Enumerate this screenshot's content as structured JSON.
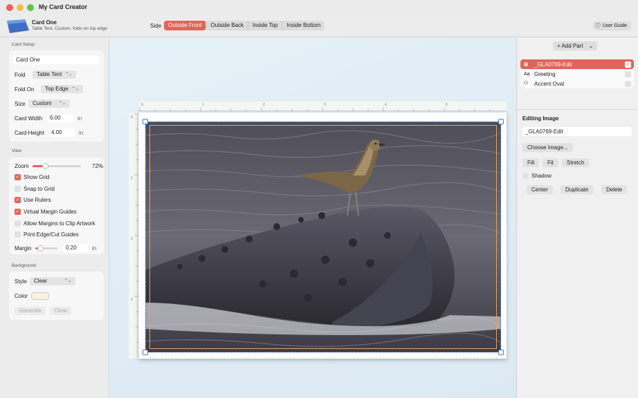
{
  "window": {
    "title": "My Card Creator"
  },
  "header": {
    "doc_name": "Card One",
    "doc_subtitle": "Table Tent, Custom, folds on top edge",
    "side_label": "Side",
    "tabs": [
      {
        "label": "Outside Front",
        "active": true
      },
      {
        "label": "Outside Back",
        "active": false
      },
      {
        "label": "Inside Top",
        "active": false
      },
      {
        "label": "Inside Bottom",
        "active": false
      }
    ],
    "user_guide_label": "User Guide"
  },
  "card_setup": {
    "title": "Card Setup",
    "name": "Card One",
    "fold_label": "Fold",
    "fold_value": "Table Tent",
    "fold_on_label": "Fold On",
    "fold_on_value": "Top Edge",
    "size_label": "Size",
    "size_value": "Custom",
    "width_label": "Card Width",
    "width_value": "6.00",
    "width_unit": "in",
    "height_label": "Card Height",
    "height_value": "4.00",
    "height_unit": "in"
  },
  "view": {
    "title": "View",
    "zoom_label": "Zoom",
    "zoom_value": "72%",
    "zoom_level": 0.72,
    "show_grid": {
      "label": "Show Grid",
      "checked": true
    },
    "snap_to_grid": {
      "label": "Snap to Grid",
      "checked": false
    },
    "use_rulers": {
      "label": "Use Rulers",
      "checked": true
    },
    "virtual_margin_guides": {
      "label": "Virtual Margin Guides",
      "checked": true
    },
    "allow_margins_clip": {
      "label": "Allow Margins to Clip Artwork",
      "checked": false
    },
    "print_edge_guides": {
      "label": "Print Edge/Cut Guides",
      "checked": false
    },
    "margin_label": "Margin",
    "margin_value": "0.20",
    "margin_unit": "in"
  },
  "background": {
    "title": "Background",
    "style_label": "Style",
    "style_value": "Clear",
    "color_label": "Color",
    "color": "#f7f4e0",
    "generate_label": "Generate",
    "clear_label": "Clear"
  },
  "rulers": {
    "h_labels": [
      "0",
      "1",
      "2",
      "3",
      "4",
      "5"
    ],
    "v_labels": [
      "0",
      "1",
      "2",
      "3"
    ]
  },
  "inspector": {
    "add_part_label": "+ Add Part",
    "parts": [
      {
        "name": "_GLA0769-Edit",
        "icon": "image-icon",
        "selected": true,
        "visible": true
      },
      {
        "name": "Greeting",
        "icon": "text-icon",
        "selected": false,
        "visible": false
      },
      {
        "name": "Accent Oval",
        "icon": "oval-icon",
        "selected": false,
        "visible": false
      }
    ],
    "editing_title": "Editing Image",
    "image_name": "_GLA0769-Edit",
    "choose_image_label": "Choose Image...",
    "fill_label": "Fill",
    "fit_label": "Fit",
    "stretch_label": "Stretch",
    "shadow_label": "Shadow",
    "center_label": "Center",
    "duplicate_label": "Duplicate",
    "delete_label": "Delete"
  },
  "colors": {
    "accent": "#e0655a",
    "selection": "#3a7bd5",
    "margin_guide": "#e1a56b"
  }
}
